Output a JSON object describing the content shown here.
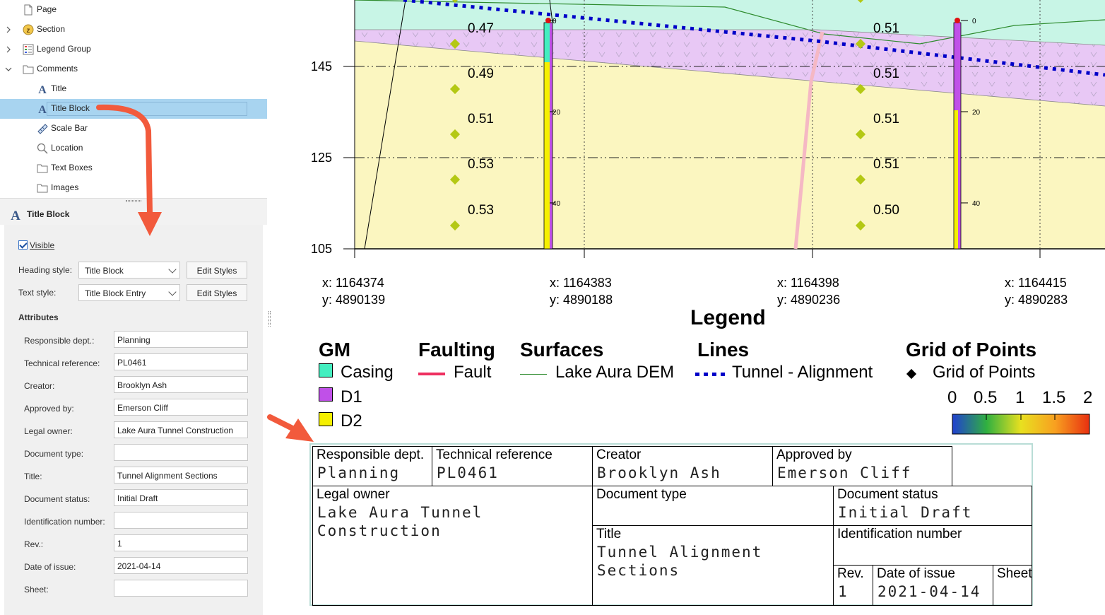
{
  "tree": {
    "items": [
      {
        "label": "Page",
        "icon": "page-icon"
      },
      {
        "label": "Section",
        "icon": "section-icon"
      },
      {
        "label": "Legend Group",
        "icon": "legend-icon"
      },
      {
        "label": "Comments",
        "icon": "folder-icon"
      },
      {
        "label": "Title",
        "icon": "title-text-icon"
      },
      {
        "label": "Title Block",
        "icon": "title-text-icon"
      },
      {
        "label": "Scale Bar",
        "icon": "ruler-icon"
      },
      {
        "label": "Location",
        "icon": "magnifier-icon"
      },
      {
        "label": "Text Boxes",
        "icon": "folder-icon"
      },
      {
        "label": "Images",
        "icon": "folder-icon"
      }
    ]
  },
  "props": {
    "header": "Title Block",
    "visible_label": "Visible",
    "heading_style_label": "Heading style:",
    "heading_style_value": "Title Block",
    "text_style_label": "Text style:",
    "text_style_value": "Title Block Entry",
    "edit_styles": "Edit Styles",
    "attributes_label": "Attributes",
    "fields": [
      {
        "label": "Responsible dept.:",
        "value": "Planning"
      },
      {
        "label": "Technical reference:",
        "value": "PL0461"
      },
      {
        "label": "Creator:",
        "value": "Brooklyn Ash"
      },
      {
        "label": "Approved by:",
        "value": "Emerson Cliff"
      },
      {
        "label": "Legal owner:",
        "value": "Lake Aura Tunnel Construction"
      },
      {
        "label": "Document type:",
        "value": ""
      },
      {
        "label": "Title:",
        "value": "Tunnel Alignment Sections"
      },
      {
        "label": "Document status:",
        "value": "Initial Draft"
      },
      {
        "label": "Identification number:",
        "value": ""
      },
      {
        "label": "Rev.:",
        "value": "1"
      },
      {
        "label": "Date of issue:",
        "value": "2021-04-14"
      },
      {
        "label": "Sheet:",
        "value": ""
      }
    ]
  },
  "section": {
    "y_ticks": [
      "145",
      "125",
      "105"
    ],
    "points_left": [
      "0.47",
      "0.49",
      "0.51",
      "0.53",
      "0.53"
    ],
    "points_right": [
      "0.51",
      "0.51",
      "0.51",
      "0.51",
      "0.50"
    ],
    "hole_left_ticks": [
      "0",
      "20",
      "40"
    ],
    "hole_right_ticks": [
      "0",
      "20",
      "40"
    ],
    "coords": [
      {
        "x": "x: 1164374",
        "y": "y: 4890139"
      },
      {
        "x": "x: 1164383",
        "y": "y: 4890188"
      },
      {
        "x": "x: 1164398",
        "y": "y: 4890236"
      },
      {
        "x": "x: 1164415",
        "y": "y: 4890283"
      }
    ],
    "colors": {
      "casing": "#c8f5e6",
      "d1": "#e8c8f5",
      "d2": "#fbf6c0",
      "fault": "#f5b8c4",
      "tunnel": "#0000c8",
      "dem": "#2e8b2e",
      "point": "#b4c814"
    }
  },
  "legend": {
    "title": "Legend",
    "gm": {
      "heading": "GM",
      "items": [
        {
          "label": "Casing",
          "color": "#44eec0"
        },
        {
          "label": "D1",
          "color": "#c050e8"
        },
        {
          "label": "D2",
          "color": "#f5f000"
        }
      ]
    },
    "faulting": {
      "heading": "Faulting",
      "item": "Fault",
      "color": "#ee3060"
    },
    "surfaces": {
      "heading": "Surfaces",
      "item": "Lake Aura DEM",
      "color": "#2e8b2e"
    },
    "lines": {
      "heading": "Lines",
      "item": "Tunnel - Alignment",
      "color": "#0000c8"
    },
    "grid": {
      "heading": "Grid of Points",
      "item": "Grid of Points"
    },
    "colorbar": {
      "labels": [
        "0",
        "0.5",
        "1",
        "1.5",
        "2"
      ],
      "colors": [
        "#2040d0",
        "#30b040",
        "#e8e020",
        "#f8a020",
        "#e83010"
      ]
    }
  },
  "titleblock": {
    "resp_dept_h": "Responsible dept.",
    "resp_dept_v": "Planning",
    "tech_ref_h": "Technical reference",
    "tech_ref_v": "PL0461",
    "creator_h": "Creator",
    "creator_v": "Brooklyn Ash",
    "approved_h": "Approved by",
    "approved_v": "Emerson Cliff",
    "legal_h": "Legal owner",
    "legal_v": "Lake Aura Tunnel\nConstruction",
    "doctype_h": "Document type",
    "docstatus_h": "Document status",
    "docstatus_v": "Initial Draft",
    "title_h": "Title",
    "title_v": "Tunnel Alignment\nSections",
    "ident_h": "Identification number",
    "rev_h": "Rev.",
    "rev_v": "1",
    "date_h": "Date of issue",
    "date_v": "2021-04-14",
    "sheet_h": "Sheet"
  }
}
